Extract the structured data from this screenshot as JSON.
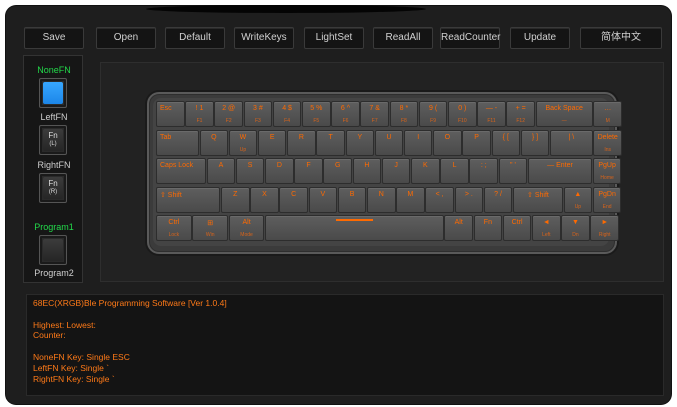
{
  "toolbar": {
    "buttons": [
      "Save",
      "Open",
      "Default",
      "WriteKeys",
      "LightSet",
      "ReadAll",
      "ReadCounter",
      "Update",
      "简体中文"
    ]
  },
  "left_panel": {
    "nonefn_label": "NoneFN",
    "leftfn_label": "LeftFN",
    "leftfn_key": "Fn",
    "leftfn_sub": "(L)",
    "rightfn_label": "RightFN",
    "rightfn_key": "Fn",
    "rightfn_sub": "(R)",
    "program1_label": "Program1",
    "program2_label": "Program2",
    "colors": {
      "active_label": "#22d94a",
      "selected_key": "#2a90f0"
    }
  },
  "keyboard": {
    "rows": [
      [
        {
          "m": "Esc",
          "s": ""
        },
        {
          "c": "! 1",
          "s": "F1"
        },
        {
          "c": "2 @",
          "s": "F2"
        },
        {
          "c": "3 #",
          "s": "F3"
        },
        {
          "c": "4 $",
          "s": "F4"
        },
        {
          "c": "5 %",
          "s": "F5"
        },
        {
          "c": "6 ^",
          "s": "F6"
        },
        {
          "c": "7 &",
          "s": "F7"
        },
        {
          "c": "8 *",
          "s": "F8"
        },
        {
          "c": "9 (",
          "s": "F9"
        },
        {
          "c": "0 )",
          "s": "F10"
        },
        {
          "c": "— -",
          "s": "F11"
        },
        {
          "c": "+ =",
          "s": "F12"
        },
        {
          "c": "Back Space",
          "s": "—"
        },
        {
          "c": "…",
          "s": "M"
        }
      ],
      [
        {
          "m": "Tab",
          "s": ""
        },
        {
          "c": "Q",
          "s": ""
        },
        {
          "c": "W",
          "s": "Up"
        },
        {
          "c": "E",
          "s": ""
        },
        {
          "c": "R",
          "s": ""
        },
        {
          "c": "T",
          "s": ""
        },
        {
          "c": "Y",
          "s": ""
        },
        {
          "c": "U",
          "s": ""
        },
        {
          "c": "I",
          "s": ""
        },
        {
          "c": "O",
          "s": ""
        },
        {
          "c": "P",
          "s": ""
        },
        {
          "c": "{ [",
          "s": ""
        },
        {
          "c": "} ]",
          "s": ""
        },
        {
          "c": "| \\",
          "s": ""
        },
        {
          "c": "Delete",
          "s": "Ins"
        }
      ],
      [
        {
          "m": "Caps Lock",
          "s": ""
        },
        {
          "c": "A",
          "s": ""
        },
        {
          "c": "S",
          "s": ""
        },
        {
          "c": "D",
          "s": ""
        },
        {
          "c": "F",
          "s": ""
        },
        {
          "c": "G",
          "s": ""
        },
        {
          "c": "H",
          "s": ""
        },
        {
          "c": "J",
          "s": ""
        },
        {
          "c": "K",
          "s": ""
        },
        {
          "c": "L",
          "s": ""
        },
        {
          "c": ": ;",
          "s": ""
        },
        {
          "c": "\" '",
          "s": ""
        },
        {
          "c": "— Enter",
          "s": ""
        },
        {
          "c": "PgUp",
          "s": "Home"
        }
      ],
      [
        {
          "m": "⇧ Shift",
          "s": ""
        },
        {
          "c": "Z",
          "s": ""
        },
        {
          "c": "X",
          "s": ""
        },
        {
          "c": "C",
          "s": ""
        },
        {
          "c": "V",
          "s": ""
        },
        {
          "c": "B",
          "s": ""
        },
        {
          "c": "N",
          "s": ""
        },
        {
          "c": "M",
          "s": ""
        },
        {
          "c": "< ,",
          "s": ""
        },
        {
          "c": "> .",
          "s": ""
        },
        {
          "c": "? /",
          "s": ""
        },
        {
          "c": "⇧ Shift",
          "s": ""
        },
        {
          "c": "▲",
          "s": "Up"
        },
        {
          "c": "PgDn",
          "s": "End"
        }
      ],
      [
        {
          "c": "Ctrl",
          "s": "Lock"
        },
        {
          "c": "⊞",
          "s": "Win"
        },
        {
          "c": "Alt",
          "s": "Mode"
        },
        {
          "c": "",
          "s": ""
        },
        {
          "c": "Alt",
          "s": ""
        },
        {
          "c": "Fn",
          "s": ""
        },
        {
          "c": "Ctrl",
          "s": ""
        },
        {
          "c": "◄",
          "s": "Left"
        },
        {
          "c": "▼",
          "s": "Dn"
        },
        {
          "c": "►",
          "s": "Right"
        }
      ]
    ]
  },
  "console": {
    "lines": [
      "68EC(XRGB)Ble Programming Software [Ver 1.0.4]",
      "",
      "Highest:      Lowest:",
      "Counter:",
      "",
      "NoneFN Key:  Single ESC",
      "LeftFN Key:  Single `",
      "RightFN Key:  Single `"
    ],
    "text_color": "#ff7a18"
  }
}
